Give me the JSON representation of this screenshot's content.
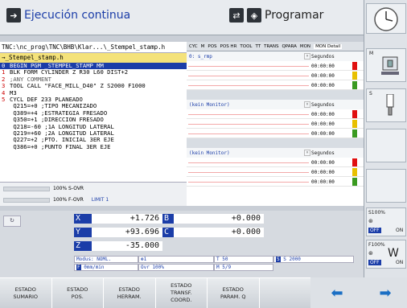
{
  "header": {
    "mode_active": "Ejecución continua",
    "mode_program": "Programar"
  },
  "program": {
    "path": "TNC:\\nc_prog\\TNC\\BHB\\Klar...\\_Stempel_stamp.h",
    "file": "→_Stempel_stamp.h",
    "lines": [
      {
        "n": "0",
        "text": "BEGIN PGM _STEMPEL_STAMP MM"
      },
      {
        "n": "1",
        "text": "BLK FORM CYLINDER Z R30 L60 DIST+2"
      },
      {
        "n": "2",
        "text": ";ANY COMMENT"
      },
      {
        "n": "3",
        "text": "TOOL CALL \"FACE_MILL_D40\" Z S2000 F1000"
      },
      {
        "n": "4",
        "text": "M3"
      },
      {
        "n": "5",
        "text": "CYCL DEF 233 PLANEADO"
      },
      {
        "n": "",
        "text": "Q215=+0     ;TIPO MECANIZADO"
      },
      {
        "n": "",
        "text": "Q389=+4     ;ESTRATEGIA FRESADO"
      },
      {
        "n": "",
        "text": "Q350=+1     ;DIRECCION FRESADO"
      },
      {
        "n": "",
        "text": "Q218=-60    ;1A LONGITUD LATERAL"
      },
      {
        "n": "",
        "text": "Q219=+60    ;2A LONGITUD LATERAL"
      },
      {
        "n": "",
        "text": "Q227=+2     ;PTO. INICIAL 3ER EJE"
      },
      {
        "n": "",
        "text": "Q386=+0     ;PUNTO FINAL 3ER EJE"
      }
    ]
  },
  "overrides": {
    "s_ovr": "100% S-OVR",
    "f_ovr": "100% F-OVR",
    "limit": "LIMIT 1"
  },
  "tabs": [
    "CYC",
    "M",
    "POS",
    "POS HR",
    "TOOL",
    "TT",
    "TRANS",
    "QPARA",
    "MON",
    "MON Detail"
  ],
  "monitor": {
    "groups": [
      {
        "name": "0: s_rmp",
        "unit": "Segundos",
        "rows": [
          "00:00:00",
          "00:00:00",
          "00:00:00"
        ]
      },
      {
        "name": "(kein Monitor)",
        "unit": "Segundos",
        "rows": [
          "00:00:00",
          "00:00:00",
          "00:00:00"
        ]
      },
      {
        "name": "(kein Monitor)",
        "unit": "Segundos",
        "rows": [
          "00:00:00",
          "00:00:00",
          "00:00:00"
        ]
      }
    ]
  },
  "axes": [
    {
      "name": "X",
      "value": "+1.726"
    },
    {
      "name": "Y",
      "value": "+93.696"
    },
    {
      "name": "Z",
      "value": "-35.000"
    }
  ],
  "axes2": [
    {
      "name": "B",
      "value": "+0.000"
    },
    {
      "name": "C",
      "value": "+0.000"
    }
  ],
  "status": {
    "modus": "Modus: NOML.",
    "feed": "0mm/min",
    "ovr": "Ovr 100%",
    "tool": "T 50",
    "spindle": "S 2000",
    "m": "M 5/9",
    "ovr_spindle": "1"
  },
  "sidebar": {
    "m_label": "M",
    "s_label": "S",
    "s100": "S100%",
    "f100": "F100%",
    "off1": "OFF",
    "on1": "ON",
    "off2": "OFF",
    "on2": "ON"
  },
  "softkeys": [
    "ESTADO\nSUMARIO",
    "ESTADO\nPOS.",
    "ESTADO\nHERRAM.",
    "ESTADO\nTRANSF.\nCOORD.",
    "ESTADO\nPARAM. Q",
    "",
    ""
  ]
}
